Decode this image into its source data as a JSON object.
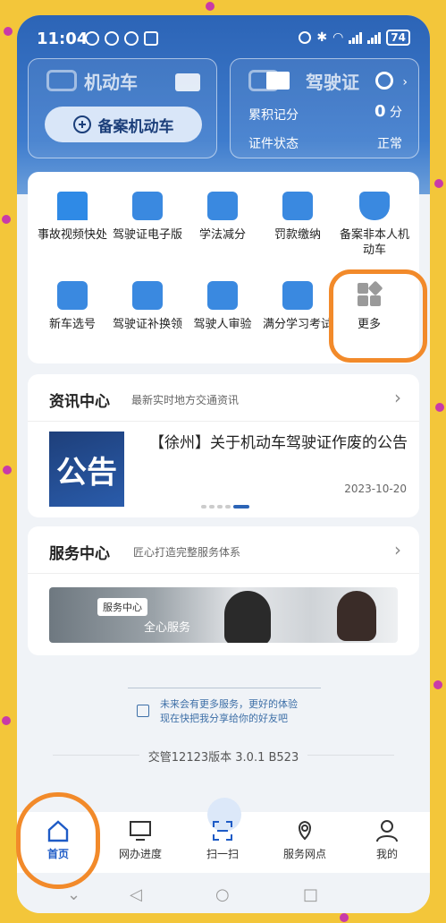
{
  "status_bar": {
    "time": "11:04",
    "battery": "74"
  },
  "vehicle_card": {
    "title": "机动车",
    "register_button": "备案机动车"
  },
  "license_card": {
    "title": "驾驶证",
    "points_label": "累积记分",
    "points_value": "0",
    "points_unit": "分",
    "status_label": "证件状态",
    "status_value": "正常"
  },
  "services_grid": [
    {
      "label": "事故视频快处",
      "icon": "siren-icon"
    },
    {
      "label": "驾驶证电子版",
      "icon": "e-license-icon"
    },
    {
      "label": "学法减分",
      "icon": "book-icon"
    },
    {
      "label": "罚款缴纳",
      "icon": "receipt-icon"
    },
    {
      "label": "备案非本人机动车",
      "icon": "shield-icon"
    },
    {
      "label": "新车选号",
      "icon": "new-plate-icon"
    },
    {
      "label": "驾驶证补换领",
      "icon": "license-renew-icon"
    },
    {
      "label": "驾驶人审验",
      "icon": "review-board-icon"
    },
    {
      "label": "满分学习考试",
      "icon": "calendar-icon"
    },
    {
      "label": "更多",
      "icon": "grid-more-icon"
    }
  ],
  "news": {
    "title": "资讯中心",
    "subtitle": "最新实时地方交通资讯",
    "image_text": "公告",
    "headline": "【徐州】关于机动车驾驶证作废的公告",
    "date": "2023-10-20"
  },
  "service_center": {
    "title": "服务中心",
    "subtitle": "匠心打造完整服务体系",
    "banner_tag": "服务中心",
    "banner_text": "全心服务"
  },
  "footer": {
    "note_line1": "未来会有更多服务，更好的体验",
    "note_line2": "现在快把我分享给你的好友吧",
    "version": "交管12123版本 3.0.1 B523"
  },
  "tabs": [
    {
      "label": "首页",
      "icon": "home-icon",
      "active": true
    },
    {
      "label": "网办进度",
      "icon": "monitor-icon",
      "active": false
    },
    {
      "label": "扫一扫",
      "icon": "scan-icon",
      "active": false
    },
    {
      "label": "服务网点",
      "icon": "map-pin-icon",
      "active": false
    },
    {
      "label": "我的",
      "icon": "user-icon",
      "active": false
    }
  ],
  "colors": {
    "primary": "#2c64b6",
    "accent_highlight": "#f28a2a",
    "active_tab": "#1e5bc6"
  }
}
